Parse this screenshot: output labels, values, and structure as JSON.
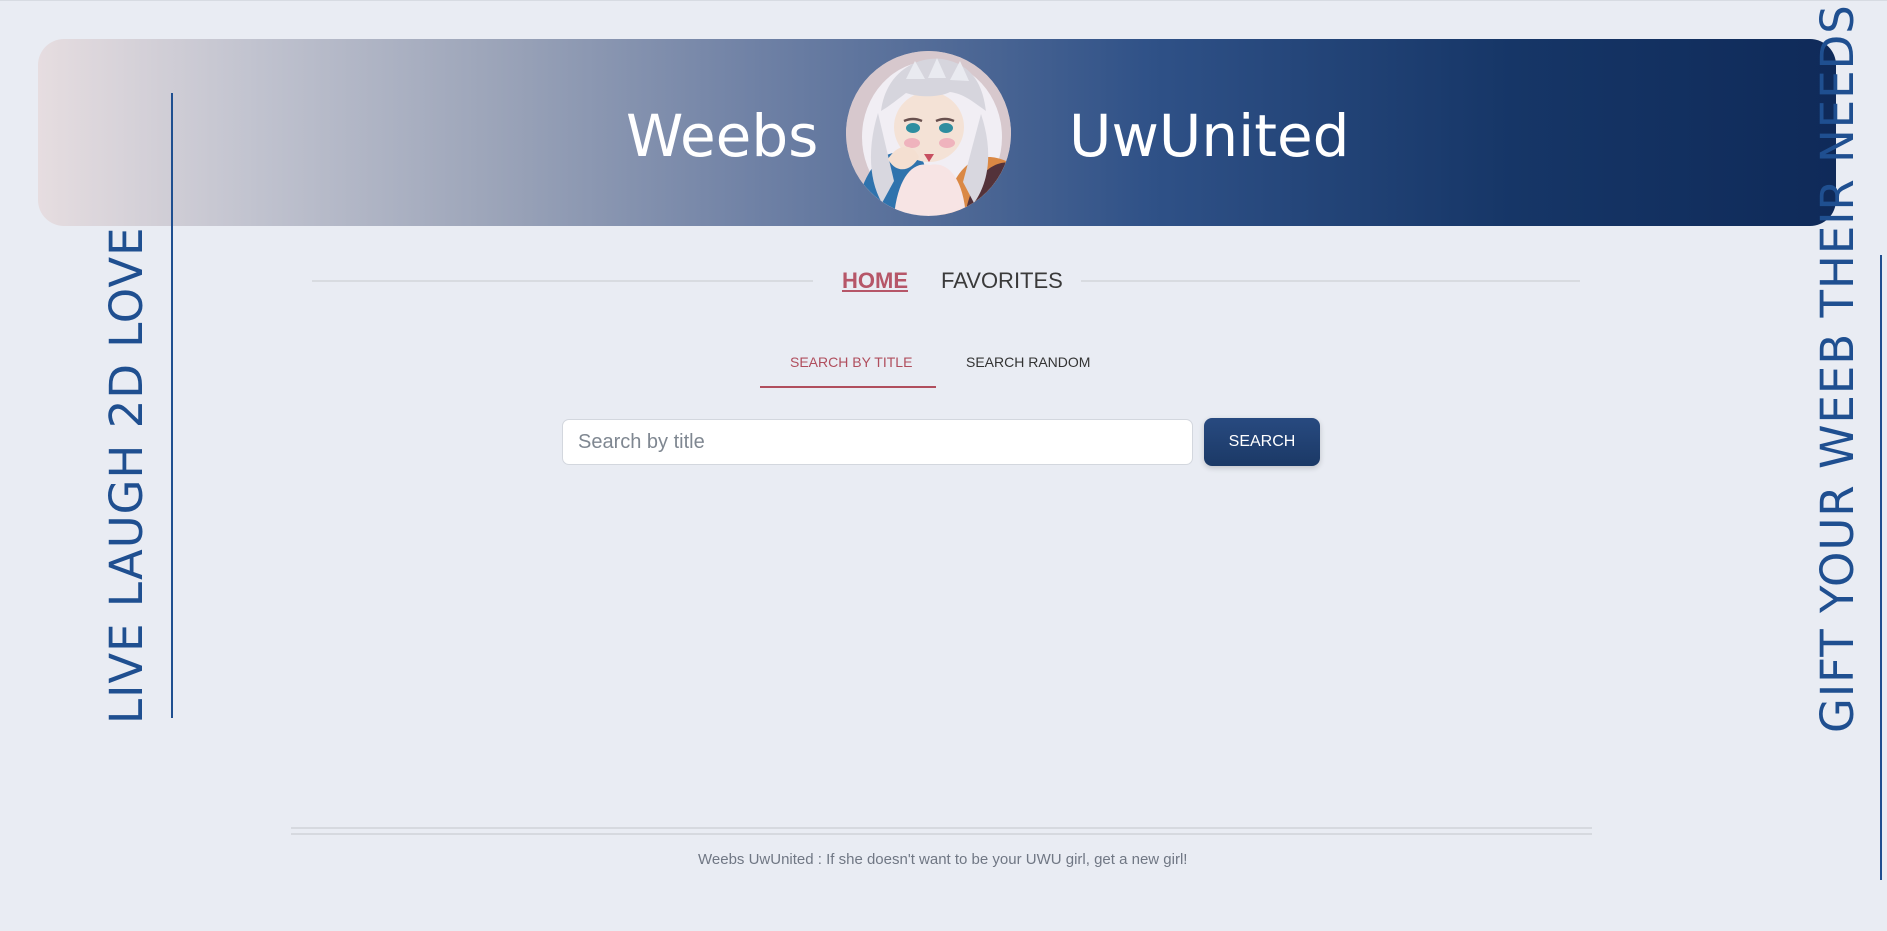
{
  "header": {
    "left_title": "Weebs",
    "right_title": "UwUnited",
    "avatar_icon": "anime-avatar-icon"
  },
  "side": {
    "left_text": "LIVE LAUGH 2D LOVE",
    "right_text": "GIFT YOUR WEEB THEIR NEEDS"
  },
  "nav": {
    "home_label": "HOME",
    "favorites_label": "FAVORITES"
  },
  "tabs": {
    "search_by_title": "SEARCH BY TITLE",
    "search_random": "SEARCH RANDOM"
  },
  "search": {
    "placeholder": "Search by title",
    "button_label": "SEARCH"
  },
  "footer": {
    "text": "Weebs UwUnited : If she doesn't want to be your UWU girl, get a new girl!"
  },
  "colors": {
    "accent": "#b04e5d",
    "brand_dark": "#1b3966",
    "side_text": "#1f4f90",
    "background": "#e9ecf3"
  }
}
